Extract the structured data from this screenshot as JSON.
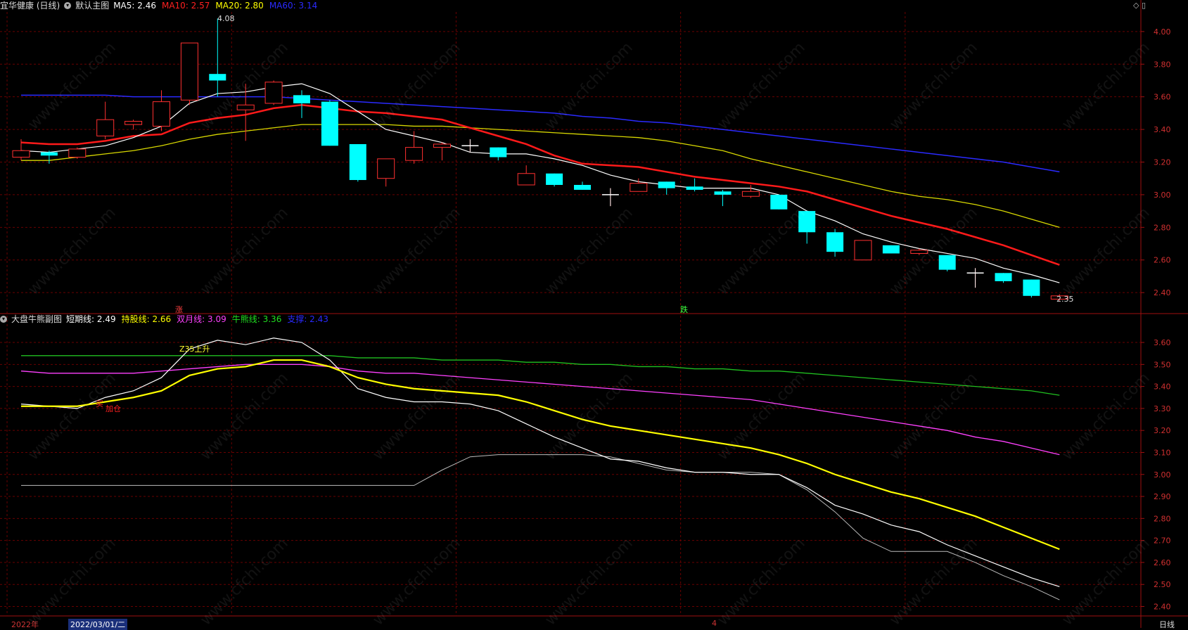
{
  "main_header": {
    "stock": "宜华健康 (日线)",
    "panel_name": "默认主图",
    "ma_labels": [
      {
        "text": "MA5: 2.46",
        "color": "#ffffff"
      },
      {
        "text": "MA10: 2.57",
        "color": "#ff2020"
      },
      {
        "text": "MA20: 2.80",
        "color": "#ffff00"
      },
      {
        "text": "MA60: 3.14",
        "color": "#2a2aff"
      }
    ]
  },
  "sub_header": {
    "panel_name": "大盘牛熊副图",
    "labels": [
      {
        "text": "短期线: 2.49",
        "color": "#ffffff"
      },
      {
        "text": "持股线: 2.66",
        "color": "#ffff00"
      },
      {
        "text": "双月线: 3.09",
        "color": "#ff40ff"
      },
      {
        "text": "牛熊线: 3.36",
        "color": "#20e020"
      },
      {
        "text": "支撑: 2.43",
        "color": "#2a2aff"
      }
    ]
  },
  "top_right_icons": "◇ ▯",
  "markers": {
    "rise": "涨",
    "fall": "跌",
    "cross": "Z35上升",
    "buy": "买",
    "add": "加仓",
    "high_label": "4.08",
    "low_label": "2.35"
  },
  "watermark": "www.cfchi.com",
  "footer": {
    "year": "2022年",
    "date": "2022/03/01/二",
    "month": "4",
    "period": "日线"
  },
  "colors": {
    "up": "#ff3030",
    "down": "#00ffff",
    "grid": "#6a0000",
    "ma5": "#ffffff",
    "ma10": "#ff1a1a",
    "ma20": "#d8d800",
    "ma60": "#2a2aff",
    "short": "#ffffff",
    "hold": "#ffff00",
    "month": "#ff40ff",
    "bull": "#20c020",
    "support": "#bbbbbb"
  },
  "chart_data": [
    {
      "type": "candlestick",
      "title": "宜华健康 (日线)",
      "ylim": [
        2.28,
        4.12
      ],
      "y_ticks": [
        2.4,
        2.6,
        2.8,
        3.0,
        3.2,
        3.4,
        3.6,
        3.8,
        4.0
      ],
      "candles": [
        {
          "o": 3.23,
          "c": 3.27,
          "h": 3.34,
          "l": 3.21
        },
        {
          "o": 3.26,
          "c": 3.24,
          "h": 3.27,
          "l": 3.19
        },
        {
          "o": 3.23,
          "c": 3.28,
          "h": 3.29,
          "l": 3.22
        },
        {
          "o": 3.36,
          "c": 3.46,
          "h": 3.57,
          "l": 3.34
        },
        {
          "o": 3.43,
          "c": 3.45,
          "h": 3.46,
          "l": 3.4
        },
        {
          "o": 3.42,
          "c": 3.57,
          "h": 3.64,
          "l": 3.39
        },
        {
          "o": 3.58,
          "c": 3.93,
          "h": 3.93,
          "l": 3.55
        },
        {
          "o": 3.74,
          "c": 3.7,
          "h": 4.08,
          "l": 3.6
        },
        {
          "o": 3.52,
          "c": 3.55,
          "h": 3.68,
          "l": 3.33
        },
        {
          "o": 3.56,
          "c": 3.69,
          "h": 3.7,
          "l": 3.55
        },
        {
          "o": 3.61,
          "c": 3.56,
          "h": 3.64,
          "l": 3.47
        },
        {
          "o": 3.57,
          "c": 3.3,
          "h": 3.58,
          "l": 3.3
        },
        {
          "o": 3.31,
          "c": 3.09,
          "h": 3.31,
          "l": 3.08
        },
        {
          "o": 3.1,
          "c": 3.22,
          "h": 3.22,
          "l": 3.05
        },
        {
          "o": 3.21,
          "c": 3.29,
          "h": 3.39,
          "l": 3.19
        },
        {
          "o": 3.29,
          "c": 3.31,
          "h": 3.32,
          "l": 3.21
        },
        {
          "o": 3.3,
          "c": 3.3,
          "h": 3.34,
          "l": 3.26
        },
        {
          "o": 3.29,
          "c": 3.23,
          "h": 3.29,
          "l": 3.21
        },
        {
          "o": 3.06,
          "c": 3.13,
          "h": 3.18,
          "l": 3.06
        },
        {
          "o": 3.13,
          "c": 3.06,
          "h": 3.13,
          "l": 3.05
        },
        {
          "o": 3.06,
          "c": 3.03,
          "h": 3.08,
          "l": 3.03
        },
        {
          "o": 3.0,
          "c": 3.0,
          "h": 3.04,
          "l": 2.93
        },
        {
          "o": 3.02,
          "c": 3.07,
          "h": 3.1,
          "l": 3.02
        },
        {
          "o": 3.08,
          "c": 3.04,
          "h": 3.08,
          "l": 3.0
        },
        {
          "o": 3.05,
          "c": 3.03,
          "h": 3.1,
          "l": 3.02
        },
        {
          "o": 3.02,
          "c": 3.0,
          "h": 3.03,
          "l": 2.93
        },
        {
          "o": 2.99,
          "c": 3.02,
          "h": 3.06,
          "l": 2.98
        },
        {
          "o": 3.0,
          "c": 2.91,
          "h": 3.0,
          "l": 2.91
        },
        {
          "o": 2.9,
          "c": 2.77,
          "h": 2.9,
          "l": 2.7
        },
        {
          "o": 2.77,
          "c": 2.65,
          "h": 2.79,
          "l": 2.62
        },
        {
          "o": 2.6,
          "c": 2.72,
          "h": 2.72,
          "l": 2.6
        },
        {
          "o": 2.69,
          "c": 2.64,
          "h": 2.69,
          "l": 2.64
        },
        {
          "o": 2.64,
          "c": 2.66,
          "h": 2.67,
          "l": 2.63
        },
        {
          "o": 2.63,
          "c": 2.54,
          "h": 2.63,
          "l": 2.53
        },
        {
          "o": 2.52,
          "c": 2.52,
          "h": 2.55,
          "l": 2.43
        },
        {
          "o": 2.52,
          "c": 2.47,
          "h": 2.52,
          "l": 2.46
        },
        {
          "o": 2.48,
          "c": 2.38,
          "h": 2.48,
          "l": 2.37
        },
        {
          "o": 2.36,
          "c": 2.38,
          "h": 2.39,
          "l": 2.35
        }
      ],
      "series": [
        {
          "name": "MA5",
          "values": [
            3.27,
            3.26,
            3.28,
            3.3,
            3.35,
            3.42,
            3.56,
            3.62,
            3.63,
            3.66,
            3.68,
            3.62,
            3.51,
            3.4,
            3.36,
            3.32,
            3.26,
            3.25,
            3.25,
            3.22,
            3.18,
            3.12,
            3.08,
            3.06,
            3.04,
            3.04,
            3.04,
            3.0,
            2.9,
            2.84,
            2.76,
            2.71,
            2.67,
            2.64,
            2.61,
            2.55,
            2.51,
            2.46
          ]
        },
        {
          "name": "MA10",
          "values": [
            3.32,
            3.31,
            3.31,
            3.33,
            3.36,
            3.37,
            3.44,
            3.47,
            3.49,
            3.53,
            3.55,
            3.53,
            3.51,
            3.5,
            3.48,
            3.46,
            3.41,
            3.36,
            3.31,
            3.24,
            3.19,
            3.18,
            3.17,
            3.14,
            3.11,
            3.09,
            3.07,
            3.05,
            3.02,
            2.97,
            2.92,
            2.87,
            2.83,
            2.79,
            2.74,
            2.69,
            2.63,
            2.57
          ]
        },
        {
          "name": "MA20",
          "values": [
            3.21,
            3.21,
            3.23,
            3.25,
            3.27,
            3.3,
            3.34,
            3.37,
            3.39,
            3.41,
            3.43,
            3.43,
            3.43,
            3.43,
            3.42,
            3.42,
            3.41,
            3.4,
            3.39,
            3.38,
            3.37,
            3.36,
            3.35,
            3.33,
            3.3,
            3.27,
            3.22,
            3.18,
            3.14,
            3.1,
            3.06,
            3.02,
            2.99,
            2.97,
            2.94,
            2.9,
            2.85,
            2.8
          ]
        },
        {
          "name": "MA60",
          "values": [
            3.61,
            3.61,
            3.61,
            3.61,
            3.6,
            3.6,
            3.6,
            3.6,
            3.6,
            3.6,
            3.59,
            3.58,
            3.57,
            3.56,
            3.55,
            3.54,
            3.53,
            3.52,
            3.51,
            3.5,
            3.48,
            3.47,
            3.45,
            3.44,
            3.42,
            3.4,
            3.38,
            3.36,
            3.34,
            3.32,
            3.3,
            3.28,
            3.26,
            3.24,
            3.22,
            3.2,
            3.17,
            3.14
          ]
        }
      ]
    },
    {
      "type": "line",
      "title": "大盘牛熊副图",
      "ylim": [
        2.36,
        3.68
      ],
      "y_ticks": [
        2.4,
        2.5,
        2.6,
        2.7,
        2.8,
        2.9,
        3.0,
        3.1,
        3.2,
        3.3,
        3.4,
        3.5,
        3.6
      ],
      "series": [
        {
          "name": "短期线",
          "values": [
            3.32,
            3.31,
            3.3,
            3.35,
            3.38,
            3.44,
            3.57,
            3.61,
            3.59,
            3.62,
            3.6,
            3.52,
            3.39,
            3.35,
            3.33,
            3.33,
            3.32,
            3.29,
            3.23,
            3.17,
            3.12,
            3.07,
            3.06,
            3.03,
            3.01,
            3.01,
            3.0,
            3.0,
            2.94,
            2.86,
            2.82,
            2.77,
            2.74,
            2.68,
            2.63,
            2.58,
            2.53,
            2.49
          ]
        },
        {
          "name": "持股线",
          "values": [
            3.31,
            3.31,
            3.31,
            3.33,
            3.35,
            3.38,
            3.45,
            3.48,
            3.49,
            3.52,
            3.52,
            3.49,
            3.44,
            3.41,
            3.39,
            3.38,
            3.37,
            3.36,
            3.33,
            3.29,
            3.25,
            3.22,
            3.2,
            3.18,
            3.16,
            3.14,
            3.12,
            3.09,
            3.05,
            3.0,
            2.96,
            2.92,
            2.89,
            2.85,
            2.81,
            2.76,
            2.71,
            2.66
          ]
        },
        {
          "name": "双月线",
          "values": [
            3.47,
            3.46,
            3.46,
            3.46,
            3.46,
            3.47,
            3.48,
            3.49,
            3.5,
            3.5,
            3.5,
            3.49,
            3.47,
            3.46,
            3.46,
            3.45,
            3.44,
            3.43,
            3.42,
            3.41,
            3.4,
            3.39,
            3.38,
            3.37,
            3.36,
            3.35,
            3.34,
            3.32,
            3.3,
            3.28,
            3.26,
            3.24,
            3.22,
            3.2,
            3.17,
            3.15,
            3.12,
            3.09
          ]
        },
        {
          "name": "牛熊线",
          "values": [
            3.54,
            3.54,
            3.54,
            3.54,
            3.54,
            3.54,
            3.54,
            3.54,
            3.54,
            3.54,
            3.54,
            3.54,
            3.53,
            3.53,
            3.53,
            3.52,
            3.52,
            3.52,
            3.51,
            3.51,
            3.5,
            3.5,
            3.49,
            3.49,
            3.48,
            3.48,
            3.47,
            3.47,
            3.46,
            3.45,
            3.44,
            3.43,
            3.42,
            3.41,
            3.4,
            3.39,
            3.38,
            3.36
          ]
        },
        {
          "name": "支撑",
          "values": [
            2.95,
            2.95,
            2.95,
            2.95,
            2.95,
            2.95,
            2.95,
            2.95,
            2.95,
            2.95,
            2.95,
            2.95,
            2.95,
            2.95,
            2.95,
            3.02,
            3.08,
            3.09,
            3.09,
            3.09,
            3.09,
            3.08,
            3.05,
            3.02,
            3.01,
            3.01,
            3.01,
            3.0,
            2.93,
            2.83,
            2.71,
            2.65,
            2.65,
            2.65,
            2.6,
            2.54,
            2.49,
            2.43
          ]
        }
      ]
    }
  ]
}
